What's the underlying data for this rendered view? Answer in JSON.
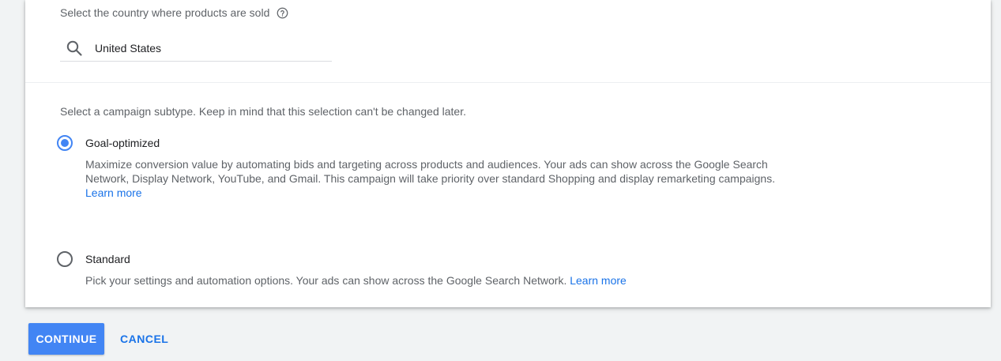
{
  "country": {
    "label": "Select the country where products are sold",
    "help_icon": "help-circle-icon",
    "search_icon": "search-icon",
    "value": "United States"
  },
  "subtype": {
    "label": "Select a campaign subtype. Keep in mind that this selection can't be changed later.",
    "options": [
      {
        "title": "Goal-optimized",
        "selected": true,
        "description": "Maximize conversion value by automating bids and targeting across products and audiences. Your ads can show across the Google Search Network, Display Network, YouTube, and Gmail. This campaign will take priority over standard Shopping and display remarketing campaigns.",
        "link": "Learn more"
      },
      {
        "title": "Standard",
        "selected": false,
        "description": "Pick your settings and automation options. Your ads can show across the Google Search Network.",
        "link": "Learn more"
      }
    ]
  },
  "actions": {
    "continue_label": "CONTINUE",
    "cancel_label": "CANCEL"
  },
  "colors": {
    "accent": "#4285f4",
    "link": "#1a73e8",
    "background": "#f1f3f4"
  }
}
